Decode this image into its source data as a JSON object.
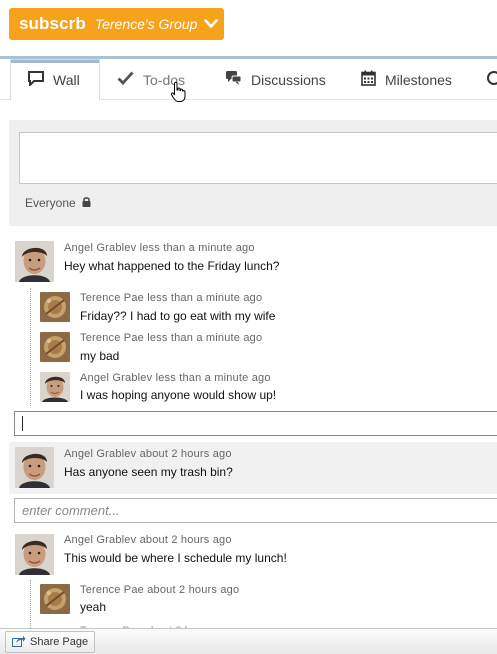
{
  "brand": {
    "logo": "subscrb",
    "group": "Terence's Group"
  },
  "colors": {
    "brand": "#f7a21b",
    "tab_accent": "#a9c1d4"
  },
  "tabs": [
    {
      "label": "Wall",
      "icon": "speech-bubble-icon",
      "active": true
    },
    {
      "label": "To-dos",
      "icon": "checkmark-icon",
      "active": false
    },
    {
      "label": "Discussions",
      "icon": "chat-bubbles-icon",
      "active": false
    },
    {
      "label": "Milestones",
      "icon": "calendar-icon",
      "active": false
    }
  ],
  "composer": {
    "audience": "Everyone",
    "audience_icon": "lock-icon"
  },
  "posts": [
    {
      "author": "Angel Grablev",
      "time": "less than a minute ago",
      "text": "Hey what happened to the Friday lunch?",
      "replies": [
        {
          "author": "Terence Pae",
          "time": "less than a minute ago",
          "text": "Friday?? I had to go eat with my wife"
        },
        {
          "author": "Terence Pae",
          "time": "less than a minute ago",
          "text": "my bad"
        },
        {
          "author": "Angel Grablev",
          "time": "less than a minute ago",
          "text": "I was hoping anyone would show up!"
        }
      ]
    },
    {
      "author": "Angel Grablev",
      "time": "about 2 hours ago",
      "text": "Has anyone seen my trash bin?",
      "comment_placeholder": "enter comment..."
    },
    {
      "author": "Angel Grablev",
      "time": "about 2 hours ago",
      "text": "This would be where I schedule my lunch!",
      "replies": [
        {
          "author": "Terence Pae",
          "time": "about 2 hours ago",
          "text": "yeah"
        }
      ]
    }
  ],
  "truncated_meta": "Terence Pae about 2 h",
  "bottombar": {
    "share_label": "Share Page"
  }
}
